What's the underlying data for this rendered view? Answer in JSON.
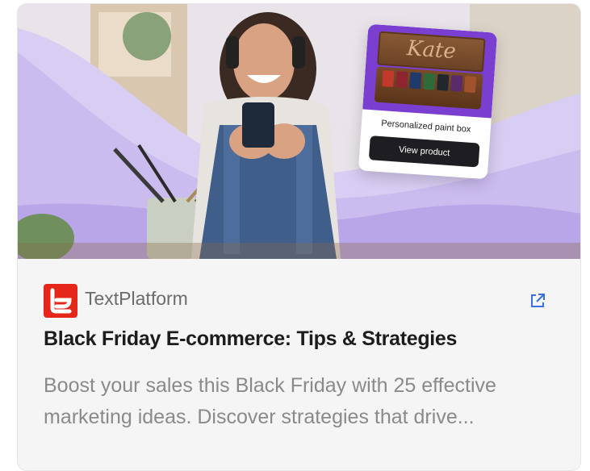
{
  "hero": {
    "product_name": "Personalized paint box",
    "button_label": "View product",
    "engraving": "Kate"
  },
  "source": {
    "name": "TextPlatform"
  },
  "article": {
    "title": "Black Friday E-commerce: Tips & Strategies",
    "description": "Boost your sales this Black Friday with 25 effective marketing ideas. Discover strategies that drive..."
  },
  "icons": {
    "logo": "textplatform-logo-icon",
    "external": "external-link-icon"
  },
  "colors": {
    "brand_red": "#e5261a",
    "accent_purple": "#7a3fd1",
    "link_blue": "#3a6fe0",
    "title": "#1c1c1e",
    "description": "#8a8a8a"
  }
}
